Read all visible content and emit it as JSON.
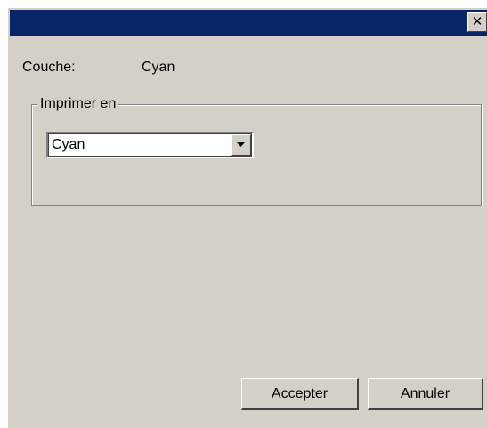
{
  "window": {
    "title": "",
    "close_glyph": "✕"
  },
  "layer": {
    "label": "Couche:",
    "value": "Cyan"
  },
  "print_group": {
    "legend": "Imprimer en",
    "selected": "Cyan"
  },
  "buttons": {
    "accept": "Accepter",
    "cancel": "Annuler"
  },
  "colors": {
    "titlebar": "#0a246a",
    "dialog_face": "#d4d0c8"
  },
  "icons": {
    "close": "close-icon",
    "dropdown": "chevron-down-icon"
  }
}
